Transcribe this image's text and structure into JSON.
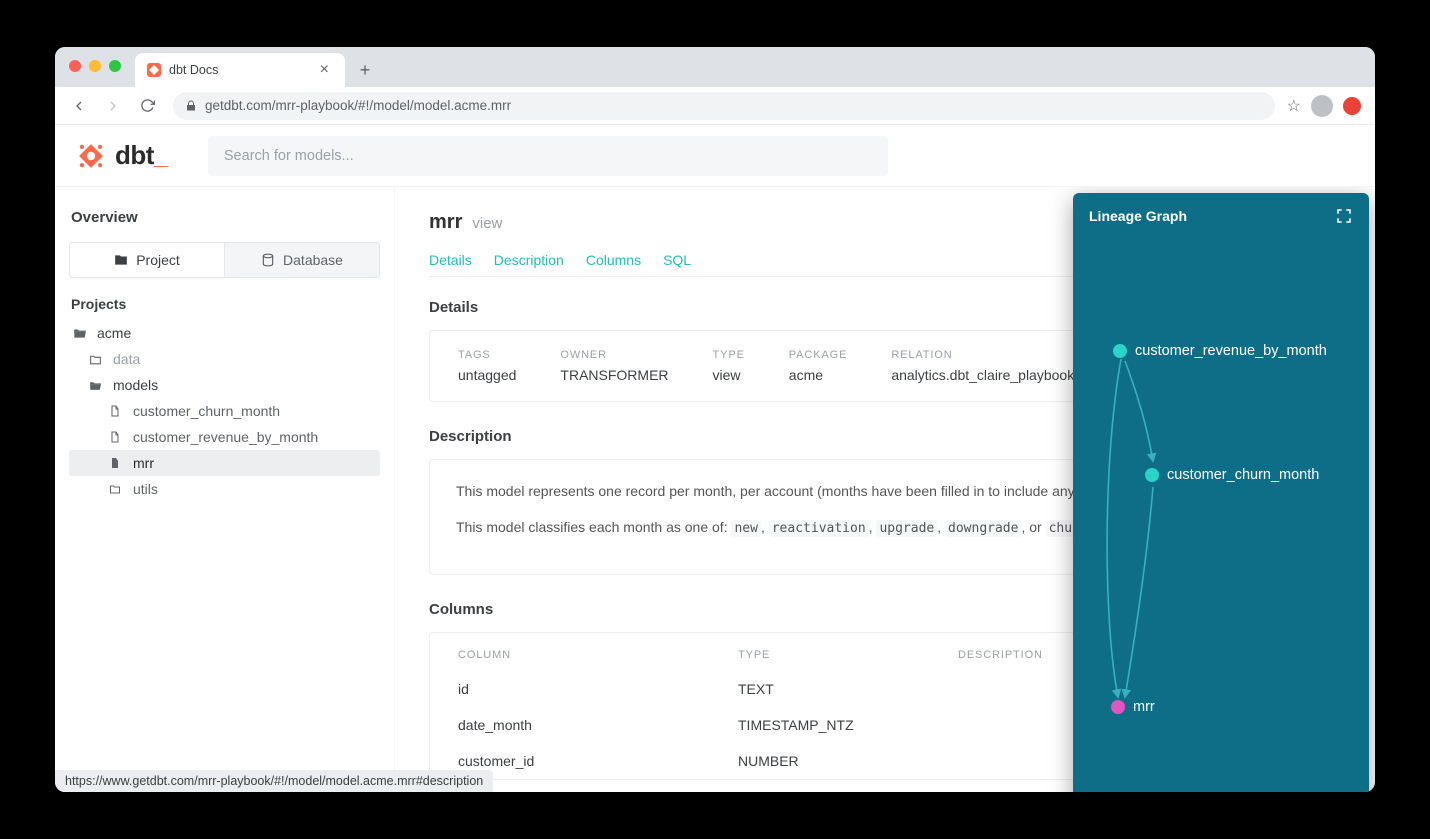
{
  "browser": {
    "tab_title": "dbt Docs",
    "url_display": "getdbt.com/mrr-playbook/#!/model/model.acme.mrr",
    "status_url": "https://www.getdbt.com/mrr-playbook/#!/model/model.acme.mrr#description"
  },
  "app": {
    "logo_text": "dbt",
    "search_placeholder": "Search for models..."
  },
  "sidebar": {
    "overview_label": "Overview",
    "project_tab": "Project",
    "database_tab": "Database",
    "projects_label": "Projects",
    "tree": {
      "root": "acme",
      "data": "data",
      "models": "models",
      "items": [
        "customer_churn_month",
        "customer_revenue_by_month",
        "mrr",
        "utils"
      ]
    }
  },
  "model": {
    "name": "mrr",
    "materialization": "view",
    "tabs": [
      "Details",
      "Description",
      "Columns",
      "SQL"
    ],
    "details": {
      "heading": "Details",
      "tags": {
        "label": "TAGS",
        "value": "untagged"
      },
      "owner": {
        "label": "OWNER",
        "value": "TRANSFORMER"
      },
      "type": {
        "label": "TYPE",
        "value": "view"
      },
      "package": {
        "label": "PACKAGE",
        "value": "acme"
      },
      "relation": {
        "label": "RELATION",
        "value": "analytics.dbt_claire_playbook.mrr"
      }
    },
    "description": {
      "heading": "Description",
      "p1": "This model represents one record per month, per account (months have been filled in to include any perio",
      "p2_prefix": "This model classifies each month as one of: ",
      "classes": [
        "new",
        "reactivation",
        "upgrade",
        "downgrade"
      ],
      "p2_sep": ", ",
      "p2_or": ", or ",
      "p2_last": "churn",
      "p2_end": "."
    },
    "columns": {
      "heading": "Columns",
      "head_column": "COLUMN",
      "head_type": "TYPE",
      "head_desc": "DESCRIPTION",
      "rows": [
        {
          "name": "id",
          "type": "TEXT"
        },
        {
          "name": "date_month",
          "type": "TIMESTAMP_NTZ"
        },
        {
          "name": "customer_id",
          "type": "NUMBER"
        }
      ]
    }
  },
  "lineage": {
    "title": "Lineage Graph",
    "nodes": {
      "n1": "customer_revenue_by_month",
      "n2": "customer_churn_month",
      "n3": "mrr"
    }
  }
}
